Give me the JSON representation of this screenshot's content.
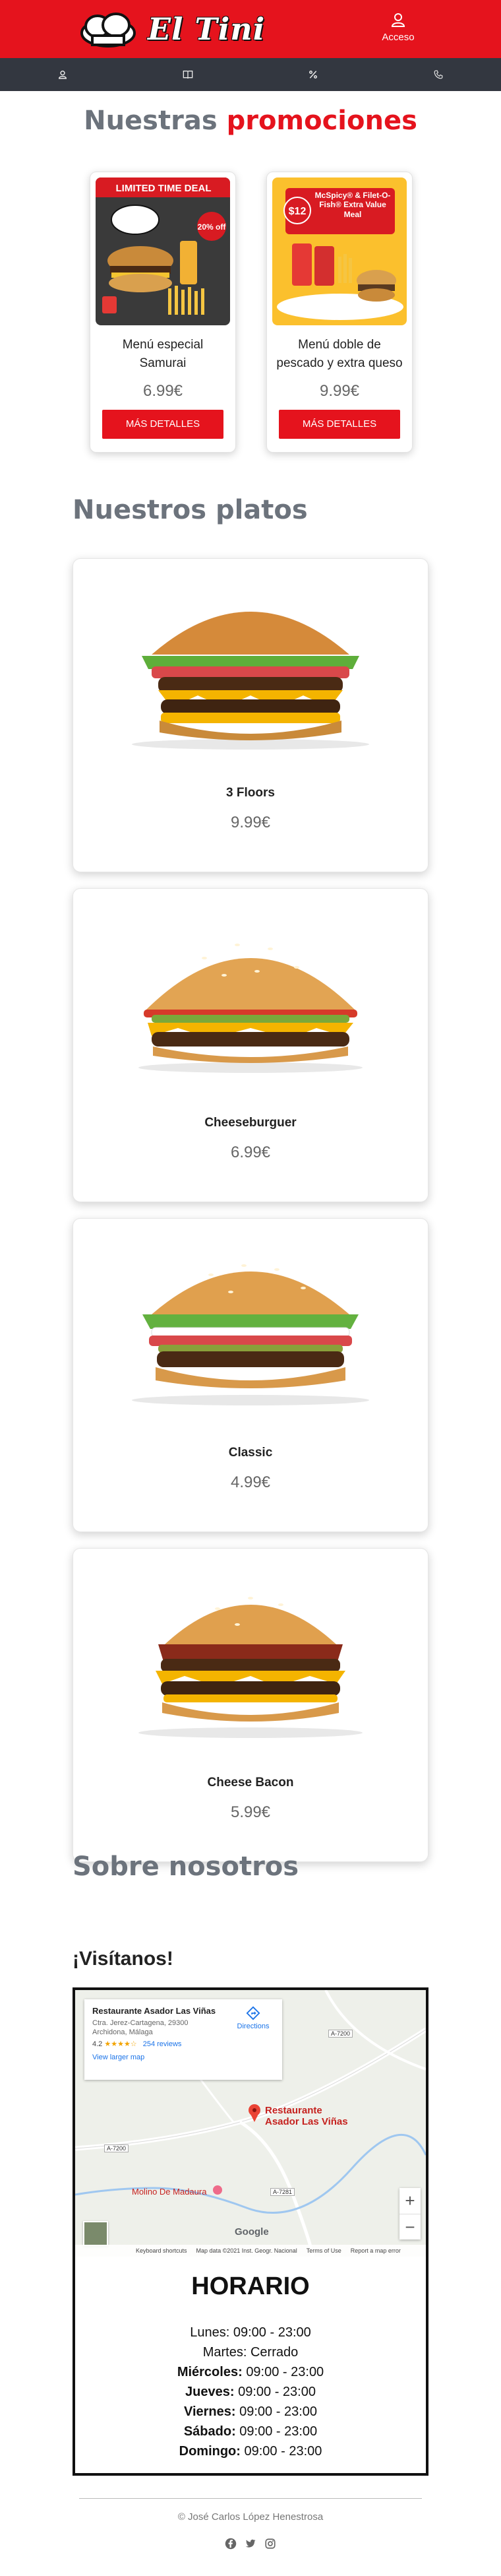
{
  "header": {
    "logo_text": "El Tini",
    "access_label": "Acceso",
    "brand_color": "#e5131d"
  },
  "nav": {
    "items": [
      {
        "icon": "user-icon"
      },
      {
        "icon": "book-icon"
      },
      {
        "icon": "percent-icon"
      },
      {
        "icon": "phone-icon"
      }
    ]
  },
  "promotions": {
    "title_prefix": "Nuestras",
    "title_accent": "promociones",
    "items": [
      {
        "image_text": "LIMITED TIME DEAL",
        "badge": "20% off",
        "name": "Menú especial Samurai",
        "price": "6.99€",
        "button": "MÁS DETALLES"
      },
      {
        "image_text": "McSpicy® & Filet-O-Fish® Extra Value Meal",
        "badge": "$12",
        "name": "Menú doble de pescado y extra queso",
        "price": "9.99€",
        "button": "MÁS DETALLES"
      }
    ]
  },
  "dishes": {
    "title": "Nuestros platos",
    "items": [
      {
        "name": "3 Floors",
        "price": "9.99€"
      },
      {
        "name": "Cheeseburguer",
        "price": "6.99€"
      },
      {
        "name": "Classic",
        "price": "4.99€"
      },
      {
        "name": "Cheese Bacon",
        "price": "5.99€"
      }
    ]
  },
  "about": {
    "title": "Sobre nosotros",
    "visit_title": "¡Visítanos!"
  },
  "map": {
    "place_name": "Restaurante Asador Las Viñas",
    "address": "Ctra. Jerez-Cartagena, 29300 Archidona, Málaga",
    "rating": "4.2",
    "stars": "★★★★☆",
    "reviews": "254 reviews",
    "larger_map": "View larger map",
    "directions": "Directions",
    "pin_label_line1": "Restaurante",
    "pin_label_line2": "Asador Las Viñas",
    "poi_label": "Molino De Madaura",
    "road_labels": [
      "A-7200",
      "A-7200",
      "A-7281"
    ],
    "footer_shortcuts": "Keyboard shortcuts",
    "footer_data": "Map data ©2021 Inst. Geogr. Nacional",
    "footer_terms": "Terms of Use",
    "footer_report": "Report a map error",
    "google": "Google",
    "zoom_in": "+",
    "zoom_out": "−"
  },
  "hours": {
    "title": "HORARIO",
    "days": [
      {
        "day": "Lunes:",
        "time": "09:00 - 23:00"
      },
      {
        "day": "Martes:",
        "time": "Cerrado"
      },
      {
        "day": "Miércoles:",
        "time": "09:00 - 23:00"
      },
      {
        "day": "Jueves:",
        "time": "09:00 - 23:00"
      },
      {
        "day": "Viernes:",
        "time": "09:00 - 23:00"
      },
      {
        "day": "Sábado:",
        "time": "09:00 - 23:00"
      },
      {
        "day": "Domingo:",
        "time": "09:00 - 23:00"
      }
    ]
  },
  "footer": {
    "copyright": "© José Carlos López Henestrosa",
    "social": [
      "facebook-icon",
      "twitter-icon",
      "instagram-icon"
    ]
  }
}
